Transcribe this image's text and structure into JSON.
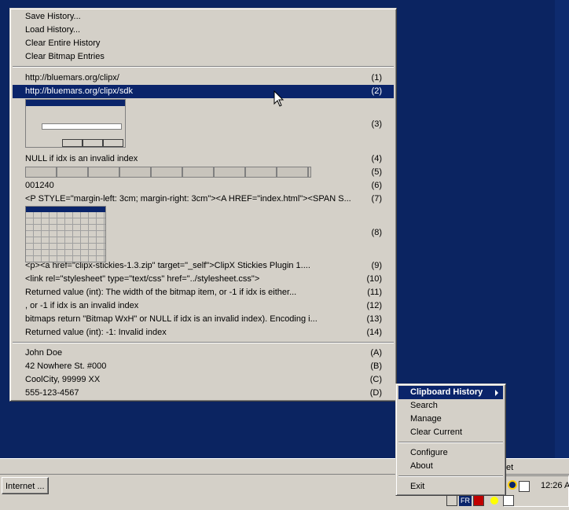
{
  "history_menu": {
    "actions": [
      {
        "label": "Save History...",
        "accel": "S"
      },
      {
        "label": "Load History...",
        "accel": "L"
      },
      {
        "label": "Clear Entire History",
        "accel": "C"
      },
      {
        "label": "Clear Bitmap Entries",
        "accel": "B"
      }
    ],
    "items": [
      {
        "label": "http://bluemars.org/clipx/",
        "key": "(1)"
      },
      {
        "label": "http://bluemars.org/clipx/sdk",
        "key": "(2)",
        "highlighted": true
      },
      {
        "label": "",
        "key": "(3)",
        "bitmap": "run-dialog"
      },
      {
        "label": "NULL if idx is an invalid index",
        "key": "(4)"
      },
      {
        "label": "",
        "key": "(5)",
        "bitmap": "taskbar-strip"
      },
      {
        "label": "001240",
        "key": "(6)"
      },
      {
        "label": "<P STYLE=\"margin-left: 3cm; margin-right: 3cm\"><A HREF=\"index.html\"><SPAN S...",
        "key": "(7)"
      },
      {
        "label": "",
        "key": "(8)",
        "bitmap": "calendar"
      },
      {
        "label": "<p><a href=\"clipx-stickies-1.3.zip\" target=\"_self\">ClipX Stickies Plugin 1....",
        "key": "(9)"
      },
      {
        "label": "<link rel=\"stylesheet\" type=\"text/css\" href=\"../stylesheet.css\">",
        "key": "(10)"
      },
      {
        "label": "Returned value (int):  The width of the bitmap item, or -1 if idx is either...",
        "key": "(11)"
      },
      {
        "label": ", or -1 if idx is an invalid index",
        "key": "(12)"
      },
      {
        "label": "bitmaps return \"Bitmap WxH\" or NULL if idx is an invalid index). Encoding i...",
        "key": "(13)"
      },
      {
        "label": "Returned value (int):  -1: Invalid index",
        "key": "(14)"
      }
    ],
    "stickies": [
      {
        "label": "John Doe",
        "key": "(A)"
      },
      {
        "label": "42 Nowhere St. #000",
        "key": "(B)"
      },
      {
        "label": "CoolCity, 99999 XX",
        "key": "(C)"
      },
      {
        "label": "555-123-4567",
        "key": "(D)"
      }
    ]
  },
  "tray_menu": {
    "items": [
      {
        "label": "Clipboard History",
        "highlighted": true,
        "submenu": true
      },
      {
        "label": "Search"
      },
      {
        "label": "Manage"
      },
      {
        "label": "Clear Current"
      },
      {
        "label": "Configure"
      },
      {
        "label": "About"
      },
      {
        "label": "Exit"
      }
    ]
  },
  "taskbar": {
    "task_button": "Internet ...",
    "tray_peek": "et",
    "clock": "12:26 A",
    "lang": "FR"
  },
  "colors": {
    "desktop": "#0b2461",
    "highlight": "#0a246a",
    "menu_face": "#d4d0c8"
  }
}
